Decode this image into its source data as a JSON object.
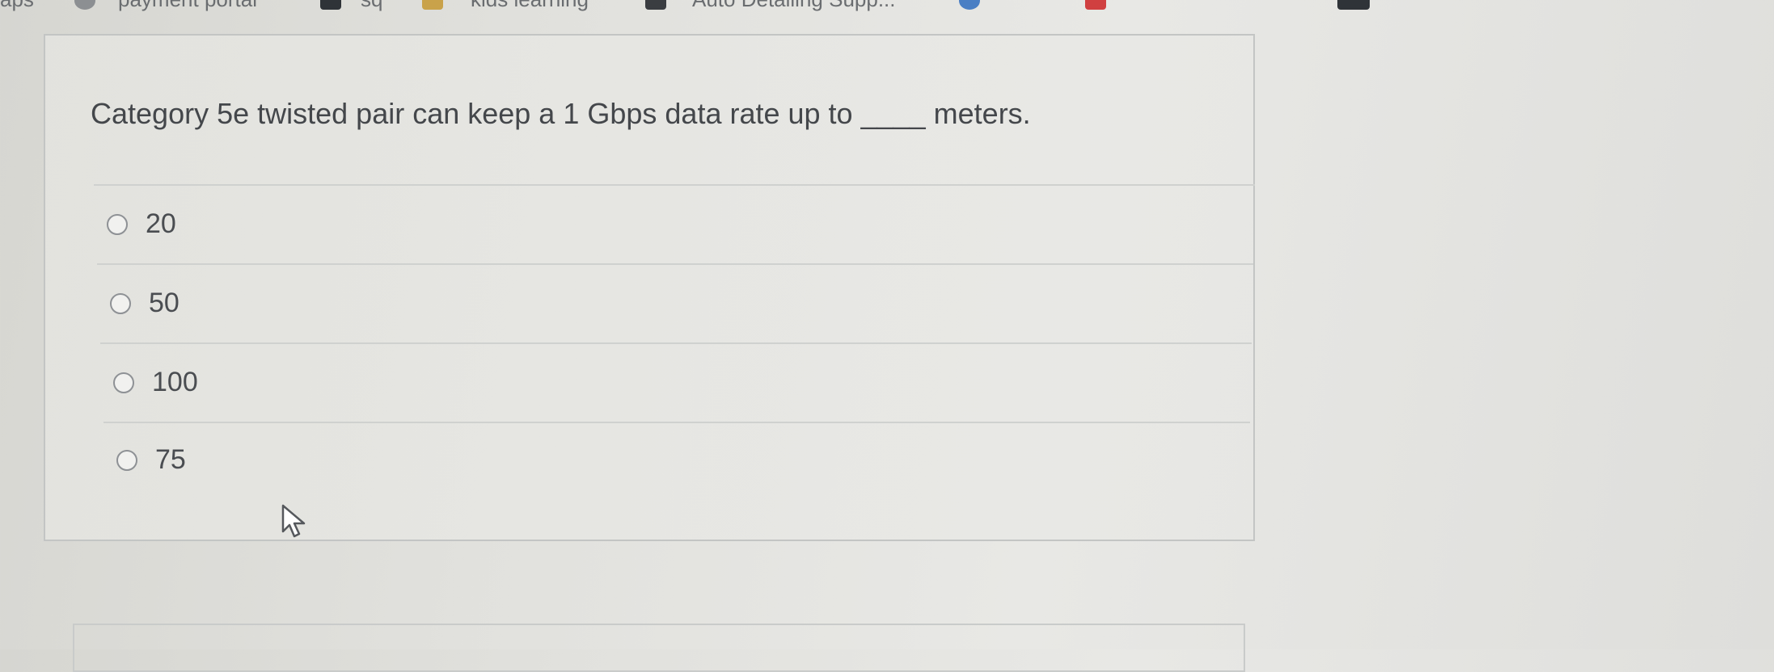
{
  "bookmarks": [
    {
      "label": "aps"
    },
    {
      "label": "payment portal"
    },
    {
      "label": "sq"
    },
    {
      "label": "kids learning"
    },
    {
      "label": "Auto Detailing Supp..."
    }
  ],
  "question": {
    "text": "Category 5e twisted pair can keep a 1 Gbps data rate up to ____ meters."
  },
  "options": [
    {
      "label": "20",
      "selected": false
    },
    {
      "label": "50",
      "selected": false
    },
    {
      "label": "100",
      "selected": false
    },
    {
      "label": "75",
      "selected": false
    }
  ],
  "colors": {
    "background": "#e1e1dd",
    "text": "#44474b",
    "border": "#c3c5c4"
  }
}
